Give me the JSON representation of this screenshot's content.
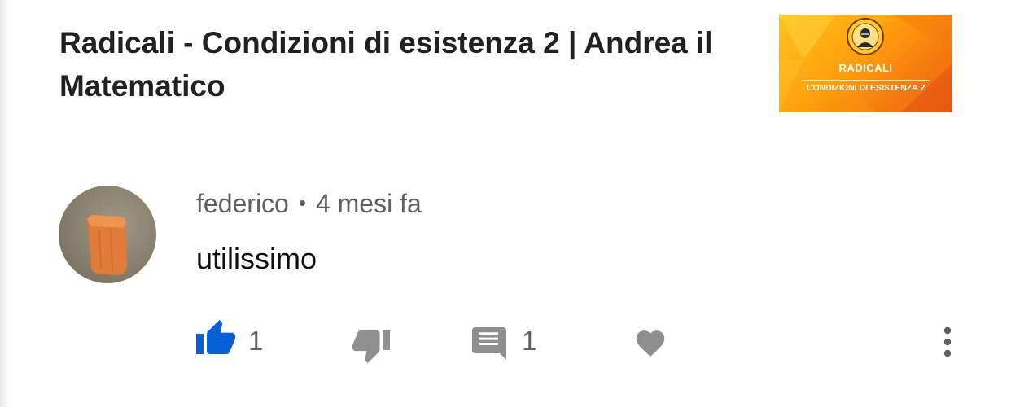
{
  "video": {
    "title": "Radicali - Condizioni di esistenza 2 | Andrea il Matematico",
    "thumbnail": {
      "title": "RADICALI",
      "subtitle": "CONDIZIONI DI ESISTENZA 2",
      "logo_icon": "mascot-badge-icon",
      "colors": {
        "bg_start": "#ffc21e",
        "bg_end": "#ee5f14",
        "text": "#ffffff"
      }
    }
  },
  "comment": {
    "author": "federico",
    "separator": "•",
    "time": "4 mesi fa",
    "text": "utilissimo",
    "avatar_icon": "user-avatar"
  },
  "actions": {
    "like": {
      "icon": "thumbs-up-icon",
      "count": "1",
      "active": true,
      "color": "#065fd4"
    },
    "dislike": {
      "icon": "thumbs-down-icon"
    },
    "reply": {
      "icon": "comment-icon",
      "count": "1"
    },
    "heart": {
      "icon": "heart-icon"
    },
    "more": {
      "icon": "more-vert-icon"
    }
  },
  "colors": {
    "text_primary": "#212121",
    "text_secondary": "#606060",
    "icon_gray": "#8f8f8f",
    "accent": "#065fd4"
  }
}
